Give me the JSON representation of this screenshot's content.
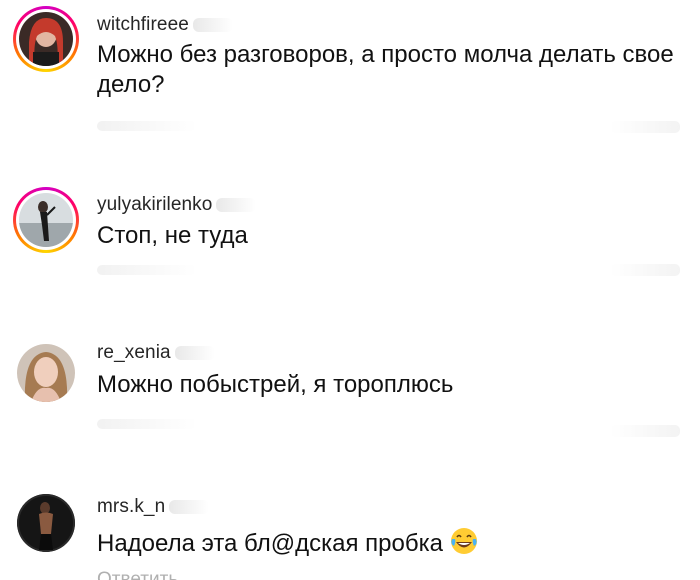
{
  "comments": [
    {
      "username": "witchfireee",
      "text": "Можно без разговоров, а просто молча делать свое дело?",
      "has_story_ring": true
    },
    {
      "username": "yulyakirilenko",
      "text": "Стоп, не туда",
      "has_story_ring": true
    },
    {
      "username": "re_xenia",
      "text": "Можно побыстрей, я тороплюсь",
      "has_story_ring": false
    },
    {
      "username": "mrs.k_n",
      "text": "Надоела эта бл@дская пробка",
      "has_story_ring": false,
      "emoji": "face-with-tears-of-joy"
    }
  ],
  "reply_label": "Ответить",
  "colors": {
    "text": "#111111",
    "username": "#262626",
    "muted": "#b0b0b0",
    "story_ring_start": "#d300c5",
    "story_ring_end": "#ffd600"
  }
}
